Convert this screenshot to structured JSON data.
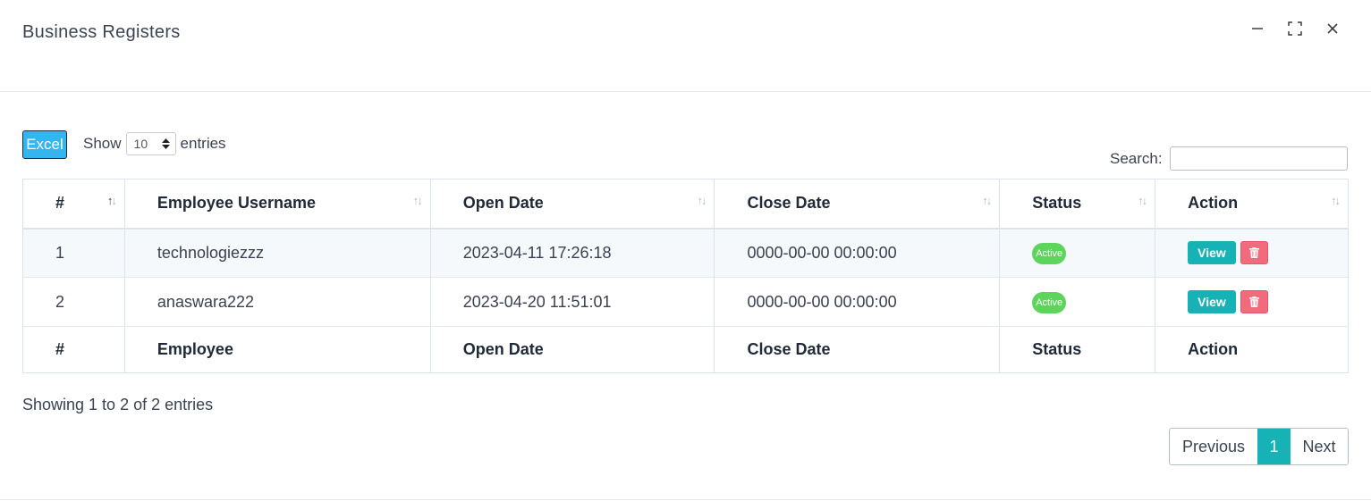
{
  "modal": {
    "title": "Business Registers"
  },
  "window_controls": {
    "minimize_icon": "minimize-icon",
    "maximize_icon": "maximize-icon",
    "close_icon": "close-icon"
  },
  "toolbar": {
    "excel_label": "Excel",
    "show_label": "Show",
    "entries_label": "entries",
    "page_length_value": "10",
    "search_label": "Search:",
    "search_value": ""
  },
  "table": {
    "headers": [
      "#",
      "Employee Username",
      "Open Date",
      "Close Date",
      "Status",
      "Action"
    ],
    "rows": [
      {
        "num": "1",
        "username": "technologiezzz",
        "open_date": "2023-04-11 17:26:18",
        "close_date": "0000-00-00 00:00:00",
        "status": "Active",
        "view_label": "View"
      },
      {
        "num": "2",
        "username": "anaswara222",
        "open_date": "2023-04-20 11:51:01",
        "close_date": "0000-00-00 00:00:00",
        "status": "Active",
        "view_label": "View"
      }
    ],
    "footers": [
      "#",
      "Employee",
      "Open Date",
      "Close Date",
      "Status",
      "Action"
    ]
  },
  "info": "Showing 1 to 2 of 2 entries",
  "pagination": {
    "previous": "Previous",
    "current": "1",
    "next": "Next"
  },
  "colors": {
    "accent": "#16b2b5",
    "excel": "#33b6f0",
    "active_badge": "#5dd45b",
    "delete": "#f26b7d"
  }
}
